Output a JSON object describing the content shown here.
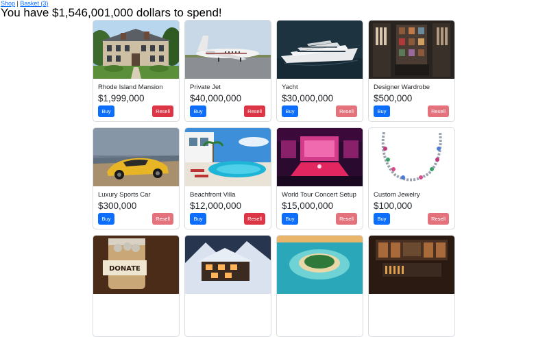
{
  "nav": {
    "shop": "Shop",
    "separator": "|",
    "basket": "Basket (3)"
  },
  "headline": "You have $1,546,001,000 dollars to spend!",
  "buttons": {
    "buy": "Buy",
    "resell": "Resell"
  },
  "colors": {
    "buy": "#0d6efd",
    "resell_active": "#dc3545",
    "resell_disabled": "#e4727d"
  },
  "items": [
    {
      "title": "Rhode Island Mansion",
      "price": "$1,999,000",
      "image": "mansion-image",
      "resell_enabled": true
    },
    {
      "title": "Private Jet",
      "price": "$40,000,000",
      "image": "jet-image",
      "resell_enabled": true
    },
    {
      "title": "Yacht",
      "price": "$30,000,000",
      "image": "yacht-image",
      "resell_enabled": false
    },
    {
      "title": "Designer Wardrobe",
      "price": "$500,000",
      "image": "wardrobe-image",
      "resell_enabled": false
    },
    {
      "title": "Luxury Sports Car",
      "price": "$300,000",
      "image": "sports-car-image",
      "resell_enabled": false
    },
    {
      "title": "Beachfront Villa",
      "price": "$12,000,000",
      "image": "villa-image",
      "resell_enabled": true
    },
    {
      "title": "World Tour Concert Setup",
      "price": "$15,000,000",
      "image": "concert-image",
      "resell_enabled": false
    },
    {
      "title": "Custom Jewelry",
      "price": "$100,000",
      "image": "jewelry-image",
      "resell_enabled": false
    },
    {
      "title": "",
      "price": "",
      "image": "donation-jar-image",
      "resell_enabled": false
    },
    {
      "title": "",
      "price": "",
      "image": "snowy-chalet-image",
      "resell_enabled": false
    },
    {
      "title": "",
      "price": "",
      "image": "private-island-image",
      "resell_enabled": false
    },
    {
      "title": "",
      "price": "",
      "image": "recording-studio-image",
      "resell_enabled": false
    }
  ]
}
